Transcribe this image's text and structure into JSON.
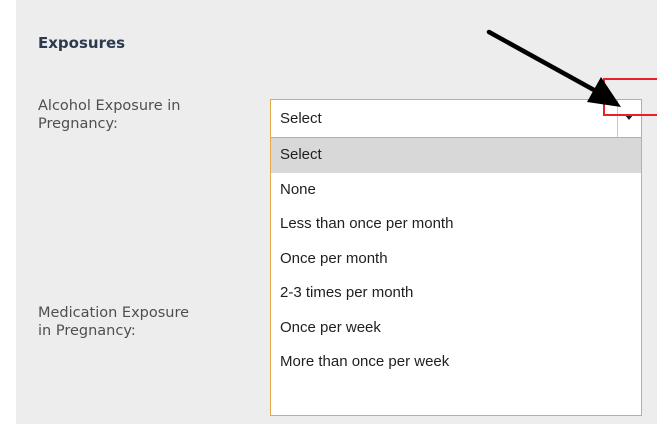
{
  "section": {
    "title": "Exposures"
  },
  "fields": {
    "alcohol_label": "Alcohol Exposure in\nPregnancy:",
    "medication_label": "Medication Exposure\nin Pregnancy:"
  },
  "alcohol_select": {
    "selected_value": "Select",
    "options": [
      "Select",
      "None",
      "Less than once per month",
      "Once per month",
      "2-3 times per month",
      "Once per week",
      "More than once per week"
    ],
    "highlighted_option_index": 0
  },
  "icons": {
    "dropdown_arrow": "caret-down-icon",
    "annotation": "black-arrow-pointer-icon"
  },
  "colors": {
    "panel_background": "#ededed",
    "field_border": "#e3a94a",
    "highlighted_option": "#d8d8d8",
    "callout_box": "#e8202a",
    "annotation_arrow": "#000000"
  }
}
